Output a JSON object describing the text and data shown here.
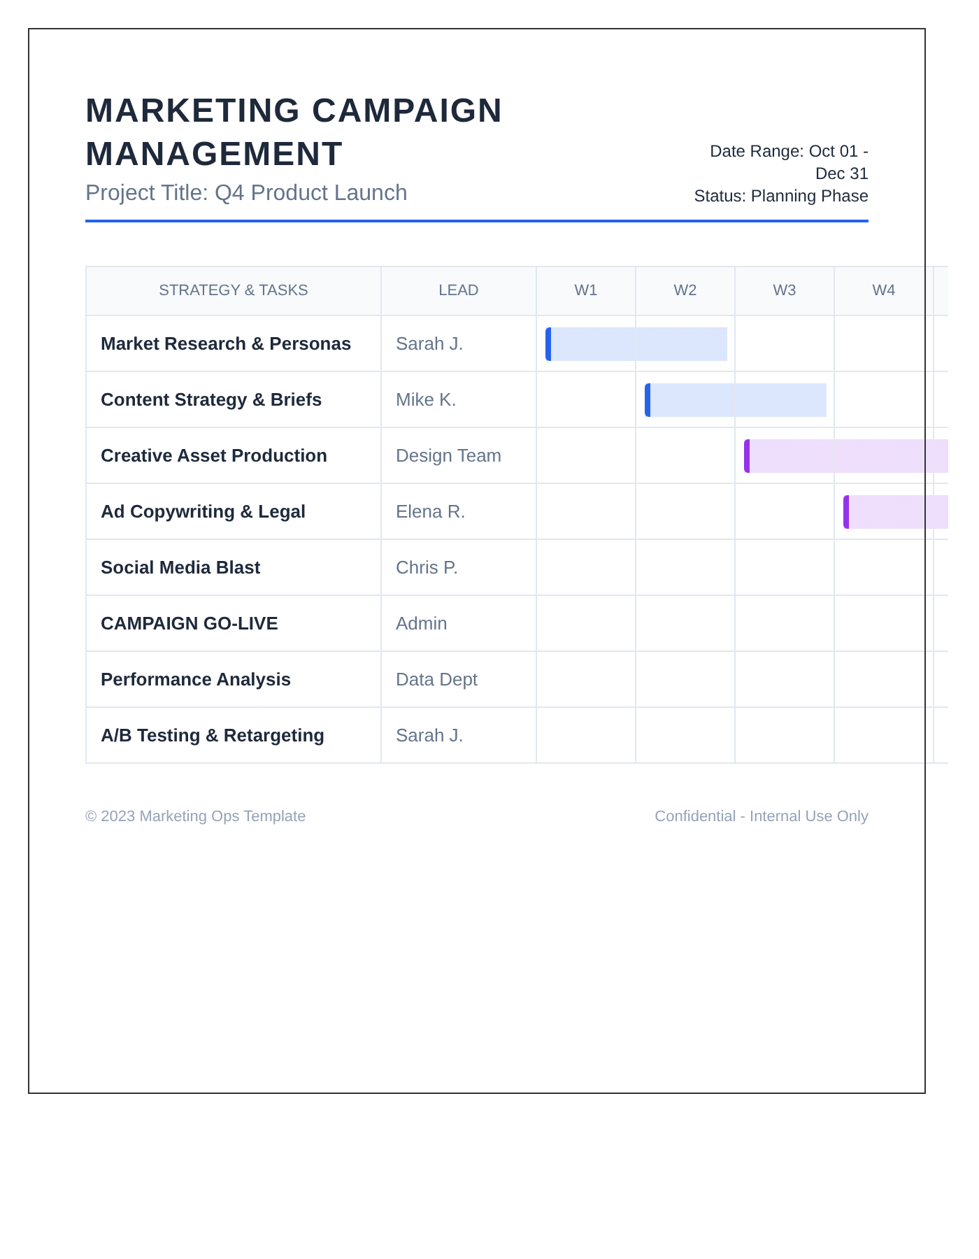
{
  "header": {
    "title": "MARKETING CAMPAIGN MANAGEMENT",
    "subtitle": "Project Title: Q4 Product Launch",
    "date_range": "Date Range: Oct 01 - Dec 31",
    "status": "Status: Planning Phase"
  },
  "table": {
    "columns": [
      "STRATEGY & TASKS",
      "LEAD",
      "W1",
      "W2",
      "W3",
      "W4"
    ],
    "rows": [
      {
        "task": "Market Research & Personas",
        "lead": "Sarah J.",
        "timeline": [
          {
            "filled": true
          },
          {
            "filled": true
          },
          {
            "filled": false
          },
          {
            "filled": false
          },
          {
            "filled": false
          }
        ],
        "color": "#2563eb"
      },
      {
        "task": "Content Strategy & Briefs",
        "lead": "Mike K.",
        "timeline": [
          {
            "filled": false
          },
          {
            "filled": true
          },
          {
            "filled": true
          },
          {
            "filled": false
          },
          {
            "filled": false
          }
        ],
        "color": "#2563eb"
      },
      {
        "task": "Creative Asset Production",
        "lead": "Design Team",
        "timeline": [
          {
            "filled": false
          },
          {
            "filled": false
          },
          {
            "filled": true
          },
          {
            "filled": true
          },
          {
            "filled": true
          }
        ],
        "color": "#9333ea"
      },
      {
        "task": "Ad Copywriting & Legal",
        "lead": "Elena R.",
        "timeline": [
          {
            "filled": false
          },
          {
            "filled": false
          },
          {
            "filled": false
          },
          {
            "filled": true
          },
          {
            "filled": true
          }
        ],
        "color": "#9333ea"
      },
      {
        "task": "Social Media Blast",
        "lead": "Chris P.",
        "timeline": [
          {
            "filled": false
          },
          {
            "filled": false
          },
          {
            "filled": false
          },
          {
            "filled": false
          },
          {
            "filled": false
          }
        ]
      },
      {
        "task": "CAMPAIGN GO-LIVE",
        "lead": "Admin",
        "timeline": [
          {
            "filled": false
          },
          {
            "filled": false
          },
          {
            "filled": false
          },
          {
            "filled": false
          },
          {
            "filled": false
          }
        ]
      },
      {
        "task": "Performance Analysis",
        "lead": "Data Dept",
        "timeline": [
          {
            "filled": false
          },
          {
            "filled": false
          },
          {
            "filled": false
          },
          {
            "filled": false
          },
          {
            "filled": false
          }
        ]
      },
      {
        "task": "A/B Testing & Retargeting",
        "lead": "Sarah J.",
        "timeline": [
          {
            "filled": false
          },
          {
            "filled": false
          },
          {
            "filled": false
          },
          {
            "filled": false
          },
          {
            "filled": false
          }
        ]
      }
    ]
  },
  "footer": {
    "left": "© 2023 Marketing Ops Template",
    "right": "Confidential - Internal Use Only"
  }
}
